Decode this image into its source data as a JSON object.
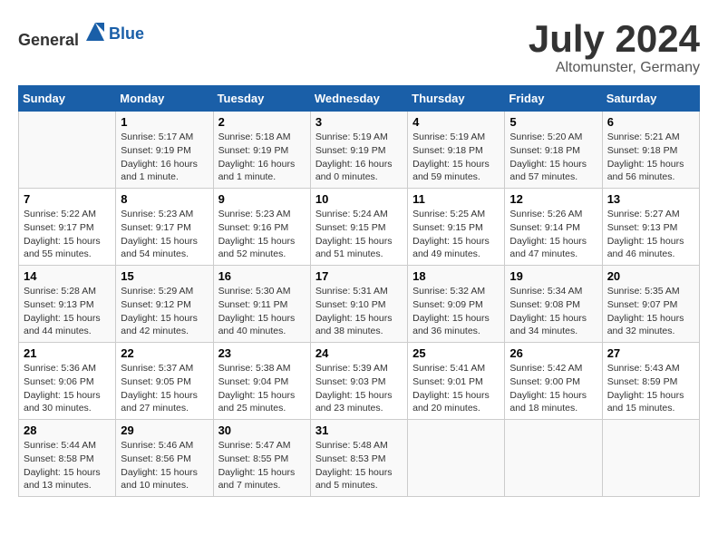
{
  "header": {
    "logo_general": "General",
    "logo_blue": "Blue",
    "month_year": "July 2024",
    "location": "Altomunster, Germany"
  },
  "calendar": {
    "days_of_week": [
      "Sunday",
      "Monday",
      "Tuesday",
      "Wednesday",
      "Thursday",
      "Friday",
      "Saturday"
    ],
    "weeks": [
      [
        {
          "day": "",
          "sunrise": "",
          "sunset": "",
          "daylight": ""
        },
        {
          "day": "1",
          "sunrise": "Sunrise: 5:17 AM",
          "sunset": "Sunset: 9:19 PM",
          "daylight": "Daylight: 16 hours and 1 minute."
        },
        {
          "day": "2",
          "sunrise": "Sunrise: 5:18 AM",
          "sunset": "Sunset: 9:19 PM",
          "daylight": "Daylight: 16 hours and 1 minute."
        },
        {
          "day": "3",
          "sunrise": "Sunrise: 5:19 AM",
          "sunset": "Sunset: 9:19 PM",
          "daylight": "Daylight: 16 hours and 0 minutes."
        },
        {
          "day": "4",
          "sunrise": "Sunrise: 5:19 AM",
          "sunset": "Sunset: 9:18 PM",
          "daylight": "Daylight: 15 hours and 59 minutes."
        },
        {
          "day": "5",
          "sunrise": "Sunrise: 5:20 AM",
          "sunset": "Sunset: 9:18 PM",
          "daylight": "Daylight: 15 hours and 57 minutes."
        },
        {
          "day": "6",
          "sunrise": "Sunrise: 5:21 AM",
          "sunset": "Sunset: 9:18 PM",
          "daylight": "Daylight: 15 hours and 56 minutes."
        }
      ],
      [
        {
          "day": "7",
          "sunrise": "Sunrise: 5:22 AM",
          "sunset": "Sunset: 9:17 PM",
          "daylight": "Daylight: 15 hours and 55 minutes."
        },
        {
          "day": "8",
          "sunrise": "Sunrise: 5:23 AM",
          "sunset": "Sunset: 9:17 PM",
          "daylight": "Daylight: 15 hours and 54 minutes."
        },
        {
          "day": "9",
          "sunrise": "Sunrise: 5:23 AM",
          "sunset": "Sunset: 9:16 PM",
          "daylight": "Daylight: 15 hours and 52 minutes."
        },
        {
          "day": "10",
          "sunrise": "Sunrise: 5:24 AM",
          "sunset": "Sunset: 9:15 PM",
          "daylight": "Daylight: 15 hours and 51 minutes."
        },
        {
          "day": "11",
          "sunrise": "Sunrise: 5:25 AM",
          "sunset": "Sunset: 9:15 PM",
          "daylight": "Daylight: 15 hours and 49 minutes."
        },
        {
          "day": "12",
          "sunrise": "Sunrise: 5:26 AM",
          "sunset": "Sunset: 9:14 PM",
          "daylight": "Daylight: 15 hours and 47 minutes."
        },
        {
          "day": "13",
          "sunrise": "Sunrise: 5:27 AM",
          "sunset": "Sunset: 9:13 PM",
          "daylight": "Daylight: 15 hours and 46 minutes."
        }
      ],
      [
        {
          "day": "14",
          "sunrise": "Sunrise: 5:28 AM",
          "sunset": "Sunset: 9:13 PM",
          "daylight": "Daylight: 15 hours and 44 minutes."
        },
        {
          "day": "15",
          "sunrise": "Sunrise: 5:29 AM",
          "sunset": "Sunset: 9:12 PM",
          "daylight": "Daylight: 15 hours and 42 minutes."
        },
        {
          "day": "16",
          "sunrise": "Sunrise: 5:30 AM",
          "sunset": "Sunset: 9:11 PM",
          "daylight": "Daylight: 15 hours and 40 minutes."
        },
        {
          "day": "17",
          "sunrise": "Sunrise: 5:31 AM",
          "sunset": "Sunset: 9:10 PM",
          "daylight": "Daylight: 15 hours and 38 minutes."
        },
        {
          "day": "18",
          "sunrise": "Sunrise: 5:32 AM",
          "sunset": "Sunset: 9:09 PM",
          "daylight": "Daylight: 15 hours and 36 minutes."
        },
        {
          "day": "19",
          "sunrise": "Sunrise: 5:34 AM",
          "sunset": "Sunset: 9:08 PM",
          "daylight": "Daylight: 15 hours and 34 minutes."
        },
        {
          "day": "20",
          "sunrise": "Sunrise: 5:35 AM",
          "sunset": "Sunset: 9:07 PM",
          "daylight": "Daylight: 15 hours and 32 minutes."
        }
      ],
      [
        {
          "day": "21",
          "sunrise": "Sunrise: 5:36 AM",
          "sunset": "Sunset: 9:06 PM",
          "daylight": "Daylight: 15 hours and 30 minutes."
        },
        {
          "day": "22",
          "sunrise": "Sunrise: 5:37 AM",
          "sunset": "Sunset: 9:05 PM",
          "daylight": "Daylight: 15 hours and 27 minutes."
        },
        {
          "day": "23",
          "sunrise": "Sunrise: 5:38 AM",
          "sunset": "Sunset: 9:04 PM",
          "daylight": "Daylight: 15 hours and 25 minutes."
        },
        {
          "day": "24",
          "sunrise": "Sunrise: 5:39 AM",
          "sunset": "Sunset: 9:03 PM",
          "daylight": "Daylight: 15 hours and 23 minutes."
        },
        {
          "day": "25",
          "sunrise": "Sunrise: 5:41 AM",
          "sunset": "Sunset: 9:01 PM",
          "daylight": "Daylight: 15 hours and 20 minutes."
        },
        {
          "day": "26",
          "sunrise": "Sunrise: 5:42 AM",
          "sunset": "Sunset: 9:00 PM",
          "daylight": "Daylight: 15 hours and 18 minutes."
        },
        {
          "day": "27",
          "sunrise": "Sunrise: 5:43 AM",
          "sunset": "Sunset: 8:59 PM",
          "daylight": "Daylight: 15 hours and 15 minutes."
        }
      ],
      [
        {
          "day": "28",
          "sunrise": "Sunrise: 5:44 AM",
          "sunset": "Sunset: 8:58 PM",
          "daylight": "Daylight: 15 hours and 13 minutes."
        },
        {
          "day": "29",
          "sunrise": "Sunrise: 5:46 AM",
          "sunset": "Sunset: 8:56 PM",
          "daylight": "Daylight: 15 hours and 10 minutes."
        },
        {
          "day": "30",
          "sunrise": "Sunrise: 5:47 AM",
          "sunset": "Sunset: 8:55 PM",
          "daylight": "Daylight: 15 hours and 7 minutes."
        },
        {
          "day": "31",
          "sunrise": "Sunrise: 5:48 AM",
          "sunset": "Sunset: 8:53 PM",
          "daylight": "Daylight: 15 hours and 5 minutes."
        },
        {
          "day": "",
          "sunrise": "",
          "sunset": "",
          "daylight": ""
        },
        {
          "day": "",
          "sunrise": "",
          "sunset": "",
          "daylight": ""
        },
        {
          "day": "",
          "sunrise": "",
          "sunset": "",
          "daylight": ""
        }
      ]
    ]
  }
}
